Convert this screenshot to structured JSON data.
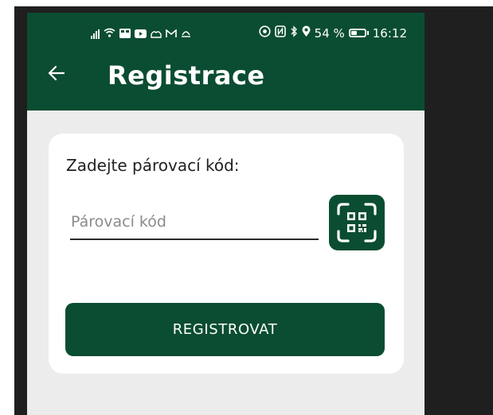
{
  "colors": {
    "primary": "#0b4d32",
    "background": "#ececec",
    "card": "#ffffff",
    "text": "#222222",
    "placeholder": "#8a8a8a"
  },
  "status_bar": {
    "left_icons": [
      "signal-icon",
      "wifi-icon",
      "notification-icon",
      "youtube-icon",
      "app-icon",
      "gmail-icon",
      "sync-icon"
    ],
    "right_icons": [
      "vpn-icon",
      "nfc-icon",
      "bluetooth-icon",
      "location-icon"
    ],
    "battery_percent": "54 %",
    "battery_level": 0.54,
    "time": "16:12"
  },
  "header": {
    "back_icon": "arrow-left-icon",
    "title": "Registrace"
  },
  "form": {
    "prompt": "Zadejte párovací kód:",
    "code_input": {
      "value": "",
      "placeholder": "Párovací kód"
    },
    "qr_icon": "qr-scan-icon",
    "submit_label": "REGISTROVAT"
  }
}
